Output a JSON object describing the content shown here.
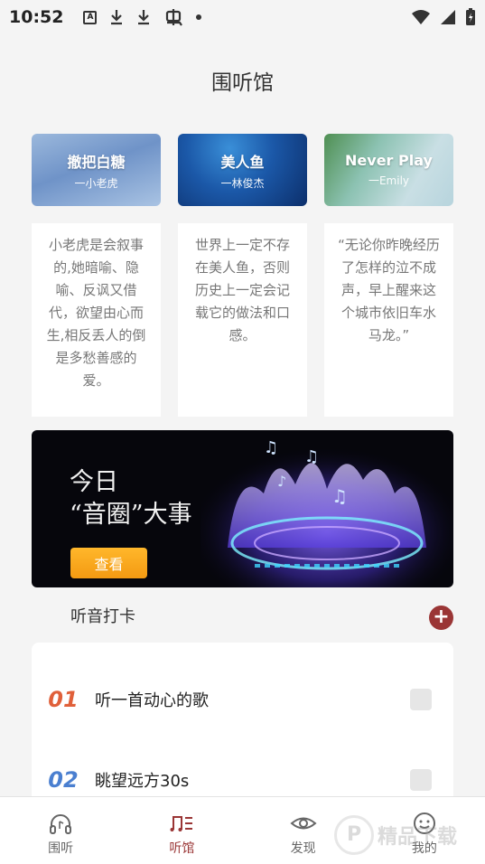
{
  "status": {
    "time": "10:52",
    "notif_a": "A"
  },
  "page": {
    "title": "围听馆"
  },
  "cards": [
    {
      "title": "撤把白糖",
      "author": "一小老虎",
      "text": "小老虎是会叙事的,她暗喻、隐喻、反讽又借代，欲望由心而生,相反丢人的倒是多愁善感的爱。"
    },
    {
      "title": "美人鱼",
      "author": "一林俊杰",
      "text": "世界上一定不存在美人鱼，否则历史上一定会记载它的做法和口感。"
    },
    {
      "title": "Never Play",
      "author": "一Emily",
      "text": "“无论你昨晚经历了怎样的泣不成声，早上醒来这个城市依旧车水马龙。”"
    }
  ],
  "banner": {
    "line1": "今日",
    "line2": "“音圈”大事",
    "button": "查看"
  },
  "section": {
    "title": "听音打卡",
    "add_icon": "+"
  },
  "tasks": [
    {
      "num": "01",
      "label": "听一首动心的歌",
      "color": "#e0603a"
    },
    {
      "num": "02",
      "label": "眺望远方30s",
      "color": "#4a7fd0"
    }
  ],
  "nav": {
    "items": [
      {
        "label": "围听",
        "icon": "headphones-icon"
      },
      {
        "label": "听馆",
        "icon": "music-list-icon"
      },
      {
        "label": "发现",
        "icon": "eye-icon"
      },
      {
        "label": "我的",
        "icon": "smile-icon"
      }
    ],
    "active": 1
  },
  "watermark": {
    "text": "精品下载"
  },
  "colors": {
    "accent": "#9a3535",
    "banner_button": "#f49a12"
  }
}
